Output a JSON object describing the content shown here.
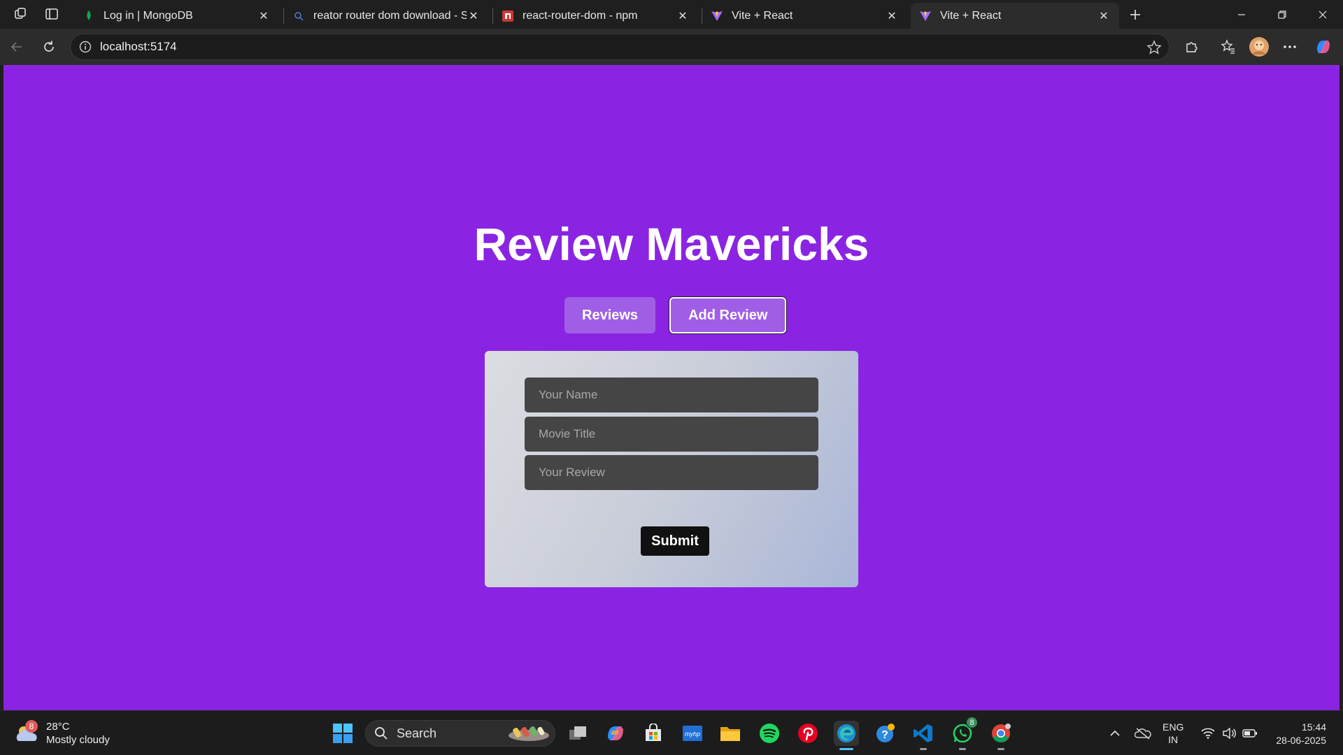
{
  "browser": {
    "tabs": [
      {
        "title": "Log in | MongoDB",
        "active": false
      },
      {
        "title": "reator router dom download - Se",
        "active": false
      },
      {
        "title": "react-router-dom - npm",
        "active": false
      },
      {
        "title": "Vite + React",
        "active": false
      },
      {
        "title": "Vite + React",
        "active": true
      }
    ],
    "url": "localhost:5174"
  },
  "page": {
    "title": "Review Mavericks",
    "nav": {
      "reviews_label": "Reviews",
      "add_review_label": "Add Review"
    },
    "form": {
      "name_placeholder": "Your Name",
      "movie_placeholder": "Movie Title",
      "review_placeholder": "Your Review",
      "submit_label": "Submit"
    },
    "colors": {
      "background": "#8a24e2",
      "nav_button": "#a05ee6",
      "submit": "#111111"
    }
  },
  "taskbar": {
    "weather": {
      "temp": "28°C",
      "condition": "Mostly cloudy",
      "badge": "8"
    },
    "search_label": "Search",
    "whatsapp_badge": "8",
    "language": {
      "line1": "ENG",
      "line2": "IN"
    },
    "time": "15:44",
    "date": "28-06-2025"
  }
}
